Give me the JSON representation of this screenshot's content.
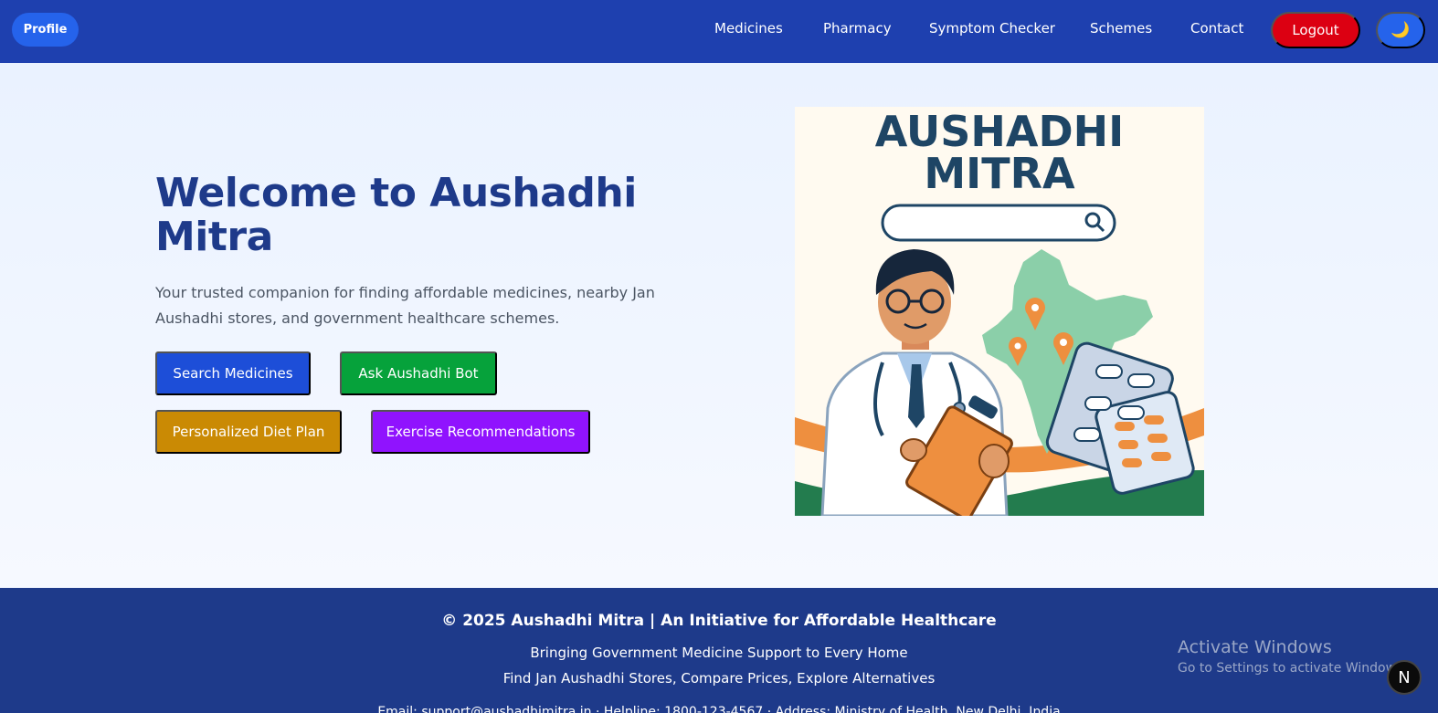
{
  "nav": {
    "profile_label": "Profile",
    "links": [
      "Medicines",
      "Pharmacy",
      "Symptom Checker",
      "Schemes",
      "Contact"
    ],
    "logout_label": "Logout",
    "theme_icon": "moon-icon",
    "theme_glyph": "🌙"
  },
  "hero": {
    "title": "Welcome to Aushadhi Mitra",
    "subtitle": "Your trusted companion for finding affordable medicines, nearby Jan Aushadhi stores, and government healthcare schemes.",
    "buttons": {
      "search": "Search Medicines",
      "bot": "Ask Aushadhi Bot",
      "diet": "Personalized Diet Plan",
      "exercise": "Exercise Recommendations"
    },
    "illustration": {
      "logo_line1": "AUSHADHI",
      "logo_line2": "MITRA"
    }
  },
  "footer": {
    "title": "© 2025 Aushadhi Mitra | An Initiative for Affordable Healthcare",
    "line1": "Bringing Government Medicine Support to Every Home",
    "line2": "Find Jan Aushadhi Stores, Compare Prices, Explore Alternatives",
    "line3": "Email: support@aushadhimitra.in · Helpline: 1800-123-4567 · Address: Ministry of Health, New Delhi, India"
  },
  "overlay": {
    "watermark_title": "Activate Windows",
    "watermark_sub": "Go to Settings to activate Windows.",
    "badge_letter": "N"
  },
  "colors": {
    "nav_bg": "#1e40af",
    "title": "#1e3a8a",
    "search_btn": "#1d4ed8",
    "bot_btn": "#06a23b",
    "diet_btn": "#ca8a04",
    "exercise_btn": "#9013fe",
    "logout_btn": "#dc0012",
    "footer_bg": "#1e3a8a"
  }
}
